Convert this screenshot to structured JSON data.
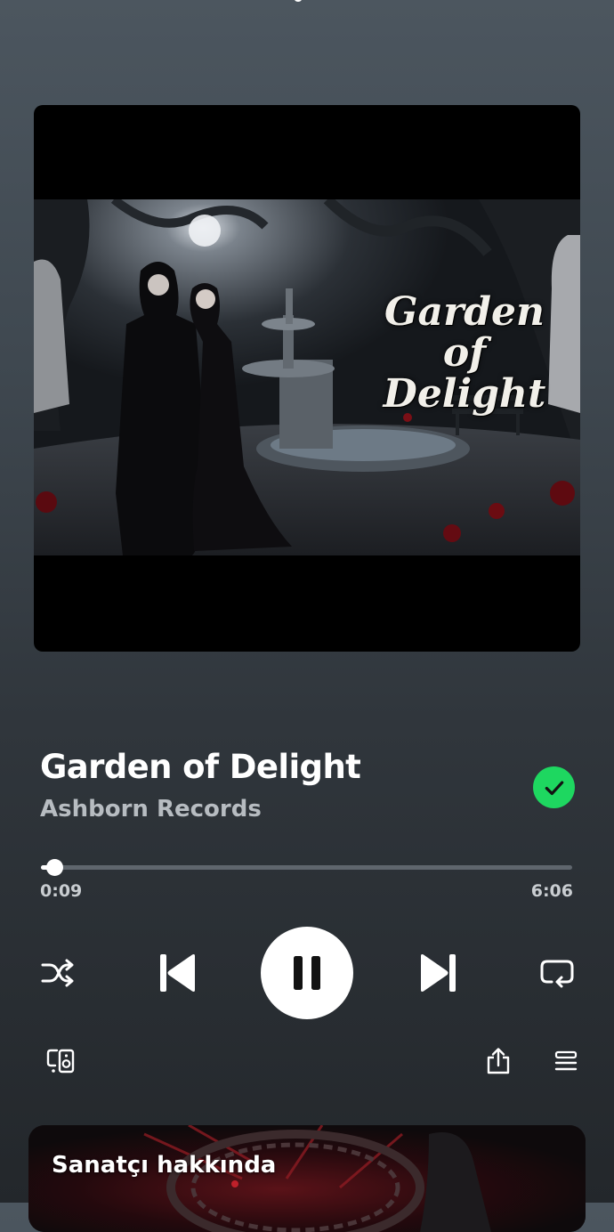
{
  "album_art": {
    "title_text": "Garden of Delight"
  },
  "track": {
    "title": "Garden of Delight",
    "artist": "Ashborn Records",
    "liked": true
  },
  "progress": {
    "elapsed": "0:09",
    "total": "6:06",
    "fraction": 0.025
  },
  "controls": {
    "shuffle_icon": "shuffle-icon",
    "previous_icon": "skip-previous-icon",
    "play_state_icon": "pause-icon",
    "next_icon": "skip-next-icon",
    "repeat_icon": "repeat-icon",
    "devices_icon": "connect-device-icon",
    "share_icon": "share-icon",
    "queue_icon": "queue-icon"
  },
  "about": {
    "title": "Sanatçı hakkında"
  },
  "colors": {
    "accent": "#1ed760",
    "background_top": "#4c565f",
    "background_bottom": "#23272b"
  }
}
